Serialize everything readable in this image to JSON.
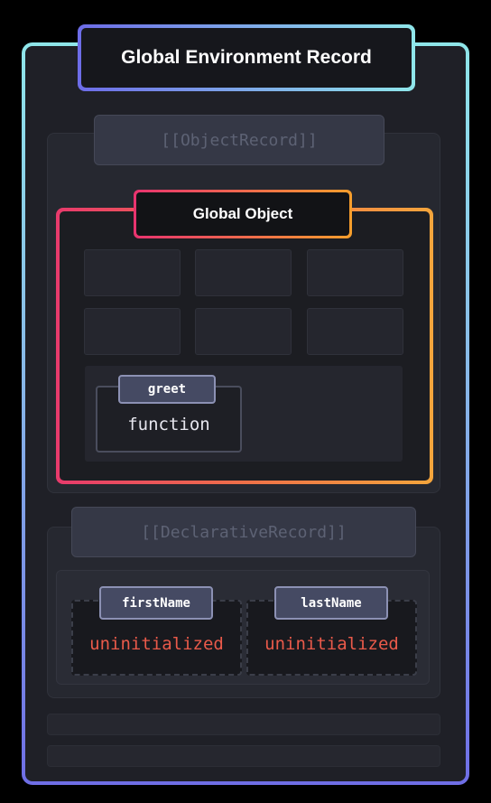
{
  "global_record": {
    "title": "Global Environment Record"
  },
  "object_record": {
    "tab_label": "[[ObjectRecord]]",
    "global_object": {
      "title": "Global Object",
      "binding": {
        "name": "greet",
        "value": "function"
      }
    }
  },
  "declarative_record": {
    "tab_label": "[[DeclarativeRecord]]",
    "bindings": [
      {
        "name": "firstName",
        "value": "uninitialized"
      },
      {
        "name": "lastName",
        "value": "uninitialized"
      }
    ]
  },
  "colors": {
    "frame_gradient": [
      "#6f6ee6",
      "#8fe6ea"
    ],
    "global_object_gradient": [
      "#e83a6c",
      "#f4a53c"
    ],
    "uninitialized_text": "#ea5a4a"
  }
}
